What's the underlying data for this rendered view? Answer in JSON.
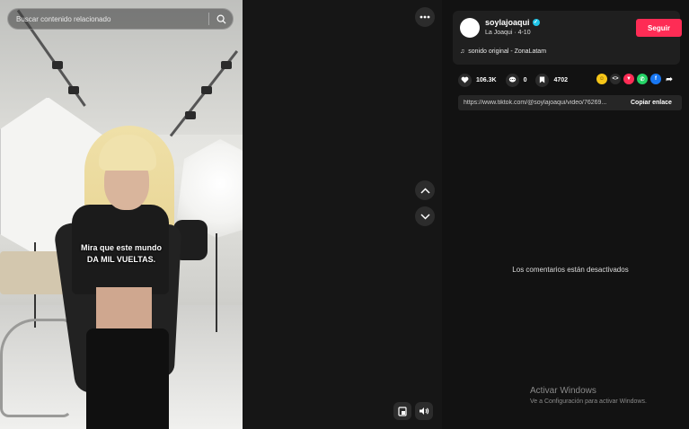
{
  "search": {
    "placeholder": "Buscar contenido relacionado"
  },
  "video": {
    "caption_line1": "Mira que este mundo",
    "caption_line2": "DA MIL VUELTAS."
  },
  "profile": {
    "username": "soylajoaqui",
    "subtitle": "La Joaqui · 4-10",
    "follow_label": "Seguir",
    "music": "sonido original - ZonaLatam"
  },
  "stats": {
    "likes": "106.3K",
    "comments": "0",
    "saves": "4702"
  },
  "share_icons": [
    "emoji-icon",
    "embed-icon",
    "send-icon",
    "whatsapp-icon",
    "facebook-icon",
    "forward-icon"
  ],
  "link": {
    "url": "https://www.tiktok.com/@soylajoaqui/video/76269...",
    "copy_label": "Copiar enlace"
  },
  "comments": {
    "disabled_text": "Los comentarios están desactivados"
  },
  "watermark": {
    "title": "Activar Windows",
    "subtitle": "Ve a Configuración para activar Windows."
  },
  "colors": {
    "follow": "#fe2c55",
    "verified": "#20c5e8",
    "background": "#121212"
  }
}
